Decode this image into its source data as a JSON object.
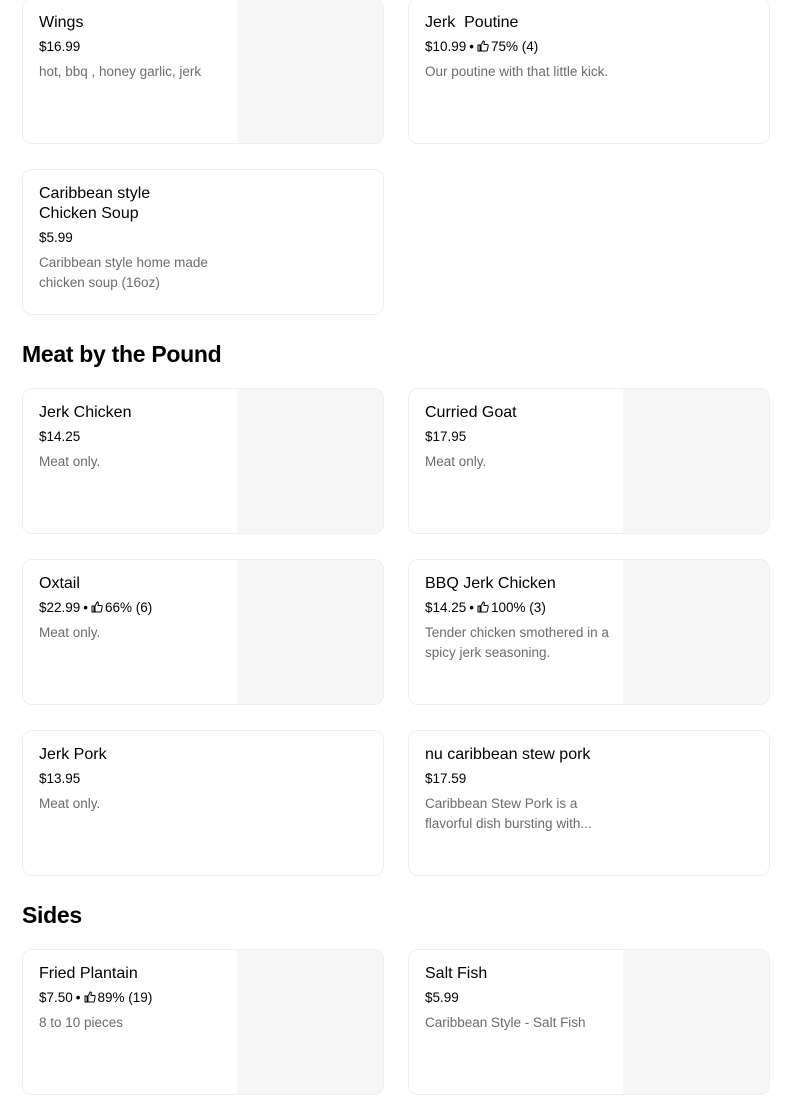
{
  "colors": {
    "card_border": "#eeeeee",
    "image_placeholder": "#f6f6f6",
    "secondary_text": "#6b6b6b"
  },
  "sections": {
    "top": {
      "items": [
        {
          "name": "Wings",
          "price": "$16.99",
          "rating": "",
          "description": "hot, bbq , honey garlic, jerk"
        },
        {
          "name": "Jerk  Poutine",
          "price": "$10.99",
          "rating": "75% (4)",
          "description": "Our poutine with that little kick."
        },
        {
          "name": "Caribbean style\nChicken Soup",
          "price": "$5.99",
          "rating": "",
          "description": "Caribbean style home made chicken soup (16oz)"
        }
      ]
    },
    "meat": {
      "title": "Meat by the Pound",
      "items": [
        {
          "name": "Jerk Chicken",
          "price": "$14.25",
          "rating": "",
          "description": "Meat only."
        },
        {
          "name": "Curried Goat",
          "price": "$17.95",
          "rating": "",
          "description": "Meat only."
        },
        {
          "name": "Oxtail",
          "price": "$22.99",
          "rating": "66% (6)",
          "description": "Meat only."
        },
        {
          "name": "BBQ Jerk Chicken",
          "price": "$14.25",
          "rating": "100% (3)",
          "description": "Tender chicken smothered in a spicy jerk seasoning."
        },
        {
          "name": "Jerk Pork",
          "price": "$13.95",
          "rating": "",
          "description": "Meat only."
        },
        {
          "name": "nu caribbean stew pork",
          "price": "$17.59",
          "rating": "",
          "description": "Caribbean Stew Pork is a flavorful dish bursting with..."
        }
      ]
    },
    "sides": {
      "title": "Sides",
      "items": [
        {
          "name": "Fried Plantain",
          "price": "$7.50",
          "rating": "89% (19)",
          "description": "8 to 10 pieces"
        },
        {
          "name": "Salt Fish",
          "price": "$5.99",
          "rating": "",
          "description": "Caribbean Style - Salt Fish"
        }
      ]
    }
  }
}
